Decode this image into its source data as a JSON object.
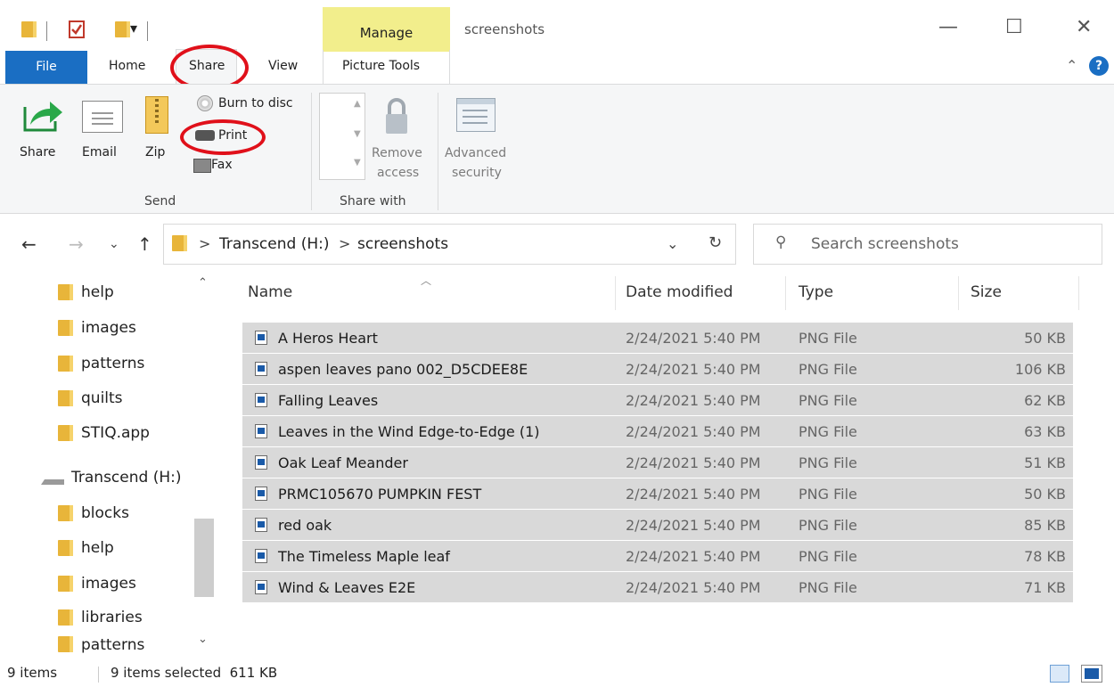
{
  "window": {
    "title": "screenshots",
    "contextual_tab": "Manage",
    "contextual_group": "Picture Tools",
    "controls": {
      "minimize": "—",
      "maximize": "☐",
      "close": "✕"
    }
  },
  "quick_access": {
    "dropdown": "▾"
  },
  "tabs": {
    "file": "File",
    "home": "Home",
    "share": "Share",
    "view": "View",
    "picture_tools": "Picture Tools"
  },
  "ribbon": {
    "send_group": {
      "label": "Send",
      "share": "Share",
      "email": "Email",
      "zip": "Zip",
      "burn": "Burn to disc",
      "print": "Print",
      "fax": "Fax"
    },
    "share_with_group": {
      "label": "Share with",
      "remove_access_1": "Remove",
      "remove_access_2": "access",
      "advanced_security_1": "Advanced",
      "advanced_security_2": "security"
    }
  },
  "address": {
    "path": [
      "Transcend (H:)",
      "screenshots"
    ],
    "separator": ">",
    "search_placeholder": "Search screenshots"
  },
  "nav_pane": {
    "items_top": [
      "help",
      "images",
      "patterns",
      "quilts",
      "STIQ.app"
    ],
    "drive": "Transcend (H:)",
    "items_drive": [
      "blocks",
      "help",
      "images",
      "libraries",
      "patterns"
    ]
  },
  "columns": {
    "name": "Name",
    "date": "Date modified",
    "type": "Type",
    "size": "Size"
  },
  "files": [
    {
      "name": "A Heros Heart",
      "date": "2/24/2021 5:40 PM",
      "type": "PNG File",
      "size": "50 KB"
    },
    {
      "name": "aspen leaves pano 002_D5CDEE8E",
      "date": "2/24/2021 5:40 PM",
      "type": "PNG File",
      "size": "106 KB"
    },
    {
      "name": "Falling Leaves",
      "date": "2/24/2021 5:40 PM",
      "type": "PNG File",
      "size": "62 KB"
    },
    {
      "name": "Leaves in the Wind Edge-to-Edge (1)",
      "date": "2/24/2021 5:40 PM",
      "type": "PNG File",
      "size": "63 KB"
    },
    {
      "name": "Oak Leaf Meander",
      "date": "2/24/2021 5:40 PM",
      "type": "PNG File",
      "size": "51 KB"
    },
    {
      "name": "PRMC105670 PUMPKIN FEST",
      "date": "2/24/2021 5:40 PM",
      "type": "PNG File",
      "size": "50 KB"
    },
    {
      "name": "red oak",
      "date": "2/24/2021 5:40 PM",
      "type": "PNG File",
      "size": "85 KB"
    },
    {
      "name": "The Timeless Maple leaf",
      "date": "2/24/2021 5:40 PM",
      "type": "PNG File",
      "size": "78 KB"
    },
    {
      "name": "Wind & Leaves E2E",
      "date": "2/24/2021 5:40 PM",
      "type": "PNG File",
      "size": "71 KB"
    }
  ],
  "status": {
    "items": "9 items",
    "selected": "9 items selected  611 KB"
  },
  "colors": {
    "file_tab": "#1a6ec3",
    "manage_tab": "#f2ee8c",
    "selection": "#d9d9d9",
    "annotation": "#e0101a"
  }
}
